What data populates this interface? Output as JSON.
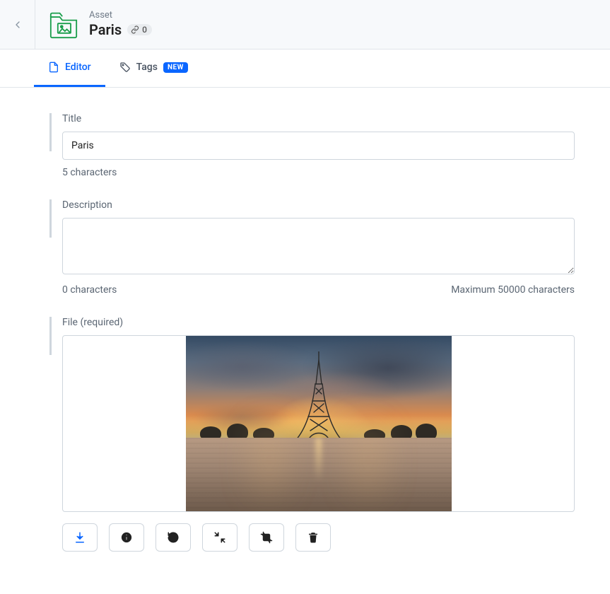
{
  "header": {
    "kind_label": "Asset",
    "title": "Paris",
    "link_count": "0"
  },
  "tabs": {
    "editor_label": "Editor",
    "tags_label": "Tags",
    "tags_badge": "NEW"
  },
  "fields": {
    "title_label": "Title",
    "title_value": "Paris",
    "title_count": "5 characters",
    "description_label": "Description",
    "description_value": "",
    "description_count": "0 characters",
    "description_max": "Maximum 50000 characters",
    "file_label": "File (required)"
  }
}
